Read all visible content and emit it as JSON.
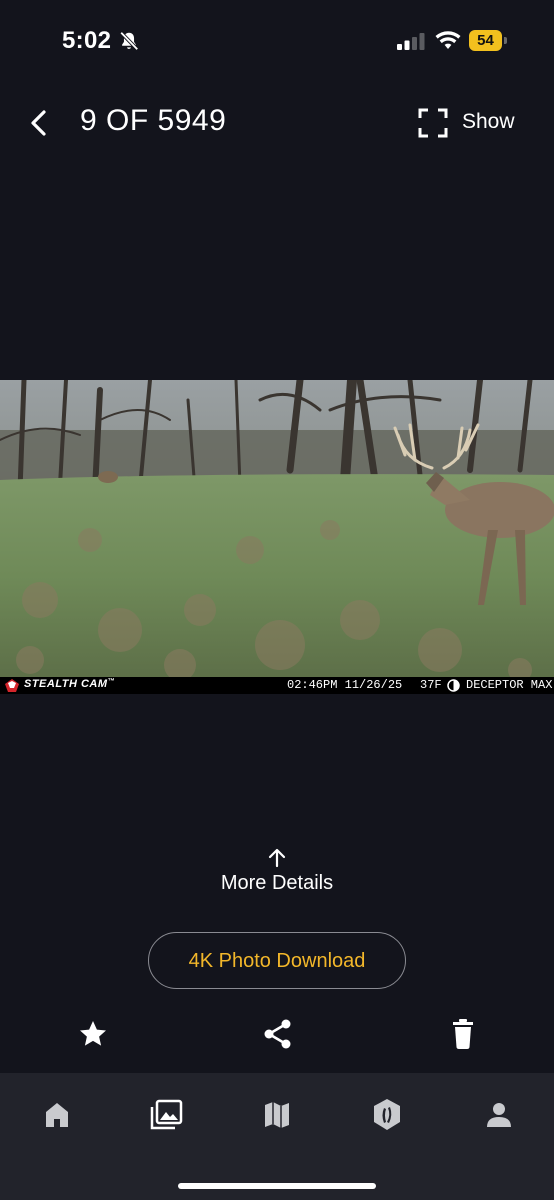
{
  "status_bar": {
    "time": "5:02",
    "battery_level": "54",
    "battery_color": "#f2c01e",
    "icons": [
      "bell-slash-icon",
      "cellular-signal-icon",
      "wifi-icon",
      "battery-icon"
    ]
  },
  "header": {
    "counter": "9 OF 5949",
    "show_label": "Show",
    "icons": [
      "chevron-left-icon",
      "fullscreen-icon"
    ]
  },
  "photo": {
    "brand": "STEALTH CAM",
    "brand_mark": "™",
    "time": "02:46PM",
    "date": "11/26/25",
    "temperature": "37F",
    "model": "DECEPTOR MAX",
    "icons": [
      "camera-logo-icon",
      "moon-phase-icon"
    ]
  },
  "details": {
    "more_label": "More Details",
    "download_label": "4K Photo Download",
    "accent_color": "#f3b72a"
  },
  "actions": {
    "icons": [
      "star-icon",
      "share-icon",
      "trash-icon"
    ]
  },
  "bottom_nav": {
    "icons": [
      "home-icon",
      "gallery-icon",
      "map-icon",
      "hunt-badge-icon",
      "user-icon"
    ],
    "background": "#22232b"
  },
  "colors": {
    "background": "#13141c",
    "text": "#ffffff"
  }
}
